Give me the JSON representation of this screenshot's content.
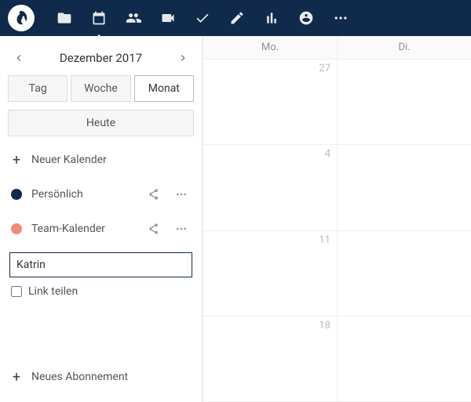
{
  "nav": {
    "items": [
      "files",
      "calendar",
      "contacts",
      "video",
      "tasks",
      "notes",
      "activity",
      "announcements",
      "more"
    ],
    "active_index": 1
  },
  "sidebar": {
    "month_title": "Dezember 2017",
    "views": {
      "day": "Tag",
      "week": "Woche",
      "month": "Monat",
      "active": "month"
    },
    "today": "Heute",
    "new_calendar": "Neuer Kalender",
    "calendars": [
      {
        "name": "Persönlich",
        "color": "#0f2a4a"
      },
      {
        "name": "Team-Kalender",
        "color": "#f08a7a"
      }
    ],
    "share_input_value": "Katrin",
    "share_link_label": "Link teilen",
    "new_subscription": "Neues Abonnement"
  },
  "grid": {
    "day_headers": [
      "Mo.",
      "Di."
    ],
    "weeks": [
      {
        "days": [
          27,
          null
        ]
      },
      {
        "days": [
          4,
          null
        ]
      },
      {
        "days": [
          11,
          null
        ]
      },
      {
        "days": [
          18,
          null
        ]
      }
    ]
  }
}
